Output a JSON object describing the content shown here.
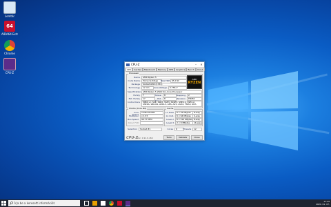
{
  "desktop": {
    "icons": [
      {
        "label": "Lomtár",
        "icon": "recycle-bin-icon"
      },
      {
        "label": "AIDA64 Extreme",
        "icon": "aida64-icon"
      },
      {
        "label": "Chrome",
        "icon": "chrome-icon"
      },
      {
        "label": "CPU-Z",
        "icon": "cpuz-icon"
      }
    ]
  },
  "cpuz": {
    "title": "CPU-Z",
    "tabs": [
      "CPU",
      "Caches",
      "Mainboard",
      "Memory",
      "SPD",
      "Graphics",
      "Bench",
      "About"
    ],
    "processor": {
      "group_title": "Processor",
      "name_label": "Name",
      "name": "AMD Ryzen 5",
      "codename_label": "Code Name",
      "codename": "Pinnacle Ridge",
      "maxtdp_label": "Max TDP",
      "maxtdp": "65.0 W",
      "package_label": "Package",
      "package": "Socket AM4 (1331)",
      "technology_label": "Technology",
      "technology": "12 nm",
      "corevoltage_label": "Core Voltage",
      "corevoltage": "0.756 V",
      "spec_label": "Specification",
      "spec": "AMD Ryzen 5 2600 Six-Core Processor",
      "family_label": "Family",
      "family": "F",
      "model_label": "Model",
      "model": "8",
      "stepping_label": "Stepping",
      "stepping": "2",
      "extfamily_label": "Ext. Family",
      "extfamily": "17",
      "extmodel_label": "Ext. Model",
      "extmodel": "8",
      "revision_label": "Revision",
      "revision": "PiR-B2",
      "instr_label": "Instructions",
      "instr": "MMX(+), SSE, SSE2, SSE3, SSSE3, SSE4.1, SSE4.2, SSE4A, x86-64, AMD-V, AES, AVX, AVX2, FMA3, SHA"
    },
    "logo": {
      "line1": "AMD",
      "line2": "RYZEN"
    },
    "clocks": {
      "group_title": "Clocks (Core #0)",
      "corespeed_label": "Core Speed",
      "corespeed": "1346.46 MHz",
      "multiplier_label": "Multiplier",
      "multiplier": "x 13.5",
      "busspeed_label": "Bus Speed",
      "busspeed": "99.77 MHz",
      "ratedfsb_label": "Rated FSB",
      "ratedfsb": ""
    },
    "cache": {
      "group_title": "Cache",
      "l1d_label": "L1 Data",
      "l1d": "6 x 32 KBytes",
      "l1d_way": "8-way",
      "l1i_label": "L1 Inst.",
      "l1i": "6 x 64 KBytes",
      "l1i_way": "4-way",
      "l2_label": "Level 2",
      "l2": "6 x 512 KBytes",
      "l2_way": "8-way",
      "l3_label": "Level 3",
      "l3": "2 x 8 MBytes",
      "l3_way": "16-way"
    },
    "selection_label": "Selection",
    "selection": "Socket #1",
    "cores_label": "Cores",
    "cores": "6",
    "threads_label": "Threads",
    "threads": "12",
    "brand": "CPU-Z",
    "version": "Ver. 1.91.0.x64",
    "tools_btn": "Tools",
    "validate_btn": "Validate",
    "close_btn": "Close"
  },
  "taskbar": {
    "search_placeholder": "Írja be a keresett információt.",
    "time": "17:29",
    "date": "2020. 01. 07."
  }
}
